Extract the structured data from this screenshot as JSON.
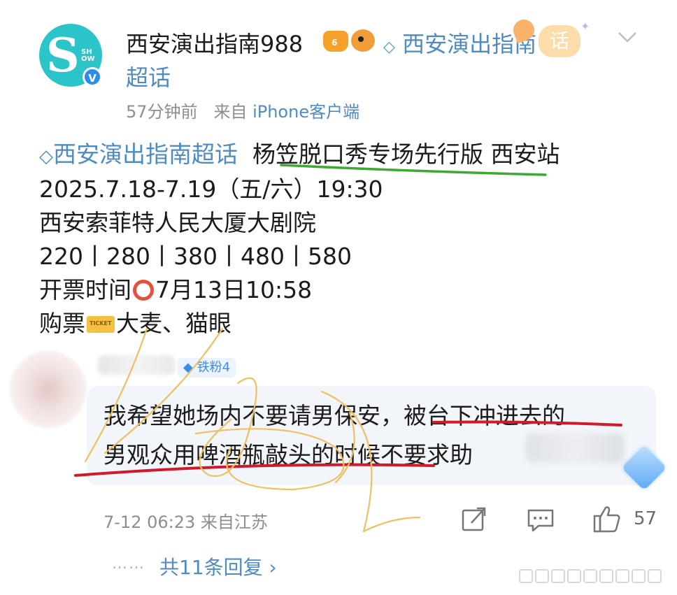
{
  "header": {
    "avatar_letter": "S",
    "avatar_sub": "SHOW",
    "verified": "V",
    "username": "西安演出指南988",
    "level_badge": "6",
    "super_topic_link": "西安演出指南",
    "sticker_text": "话",
    "super_topic_line2": "超话",
    "time_ago": "57分钟前",
    "from_label": "来自",
    "source": "iPhone客户端"
  },
  "post": {
    "topic_tag": "西安演出指南超话",
    "show_title": "杨笠脱口秀专场先行版 西安站",
    "date_line": "2025.7.18-7.19（五/六）19:30",
    "venue": "西安索菲特人民大厦大剧院",
    "prices": "220丨280丨380丨480丨580",
    "sale_time_label": "开票时间",
    "sale_time": "7月13日10:58",
    "buy_label": "购票",
    "buy_channels": "大麦、猫眼"
  },
  "comment": {
    "fan_badge": "铁粉4",
    "line1": "我希望她场内不要请男保安，被台下冲进去的",
    "line2": "男观众用啤酒瓶敲头的时候不要求助",
    "time": "7-12 06:23",
    "location": "来自江苏",
    "like_count": "57",
    "dots": "……",
    "replies_label": "共11条回复 ›"
  },
  "icons": {
    "share": "share-icon",
    "comment": "comment-icon",
    "like": "thumbs-up-icon",
    "chevron": "chevron-down-icon"
  },
  "colors": {
    "link_blue": "#4f8bc3",
    "annotation_green": "#3ea832",
    "annotation_red": "#d01a2a",
    "scribble_yellow": "#f0c060"
  }
}
